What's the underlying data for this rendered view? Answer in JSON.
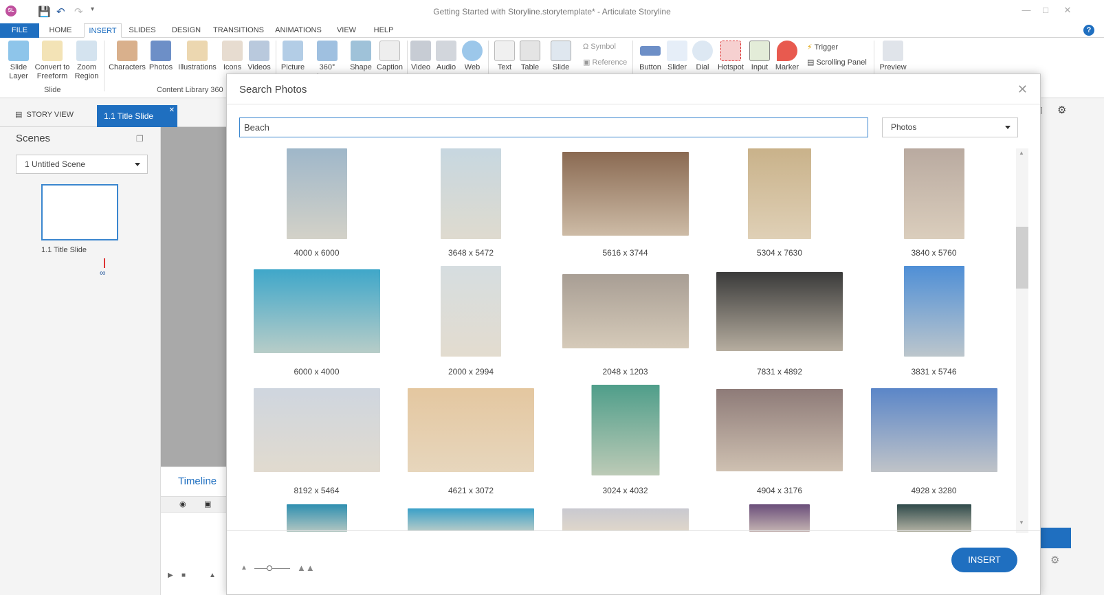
{
  "app": {
    "logo_text": "SL",
    "window_title": "Getting Started with Storyline.storytemplate* - Articulate Storyline"
  },
  "menu": {
    "tabs": [
      "FILE",
      "HOME",
      "INSERT",
      "SLIDES",
      "DESIGN",
      "TRANSITIONS",
      "ANIMATIONS",
      "VIEW",
      "HELP"
    ],
    "active": "INSERT"
  },
  "ribbon": {
    "slide_group": {
      "slide_layer": "Slide\nLayer",
      "convert": "Convert to\nFreeform",
      "zoom": "Zoom\nRegion",
      "label": "Slide"
    },
    "content_group": {
      "characters": "Characters",
      "photos": "Photos",
      "illustrations": "Illustrations",
      "icons": "Icons",
      "videos": "Videos",
      "label": "Content Library 360"
    },
    "media_group": {
      "picture": "Picture",
      "image360": "360° Image",
      "shape": "Shape",
      "caption": "Caption",
      "video": "Video",
      "audio": "Audio",
      "web": "Web"
    },
    "text_group": {
      "text": "Text",
      "table": "Table",
      "slide": "Slide",
      "symbol": "Symbol",
      "reference": "Reference"
    },
    "interactive_group": {
      "button": "Button",
      "slider": "Slider",
      "dial": "Dial",
      "hotspot": "Hotspot",
      "input": "Input",
      "marker": "Marker",
      "trigger": "Trigger",
      "scrolling_panel": "Scrolling Panel"
    },
    "preview": "Preview"
  },
  "view_tabs": {
    "story_view": "STORY VIEW",
    "title_slide": "1.1 Title Slide"
  },
  "scenes": {
    "title": "Scenes",
    "selected": "1 Untitled Scene",
    "thumb_label": "1.1 Title Slide"
  },
  "timeline": {
    "title": "Timeline"
  },
  "dialog": {
    "title": "Search Photos",
    "search_value": "Beach",
    "type_value": "Photos",
    "insert_label": "INSERT",
    "photos": [
      {
        "size": "4000 x 6000",
        "color": "#9fb7c9"
      },
      {
        "size": "3648 x 5472",
        "color": "#c7d7e0"
      },
      {
        "size": "5616 x 3744",
        "color": "#8a6a52"
      },
      {
        "size": "5304 x 7630",
        "color": "#c9b28a"
      },
      {
        "size": "3840 x 5760",
        "color": "#b9aaa0"
      },
      {
        "size": "6000 x 4000",
        "color": "#3fa7c9"
      },
      {
        "size": "2000 x 2994",
        "color": "#d6dde0"
      },
      {
        "size": "2048 x 1203",
        "color": "#a89e94"
      },
      {
        "size": "7831 x 4892",
        "color": "#3a3a3a"
      },
      {
        "size": "3831 x 5746",
        "color": "#4f8fd6"
      },
      {
        "size": "8192 x 5464",
        "color": "#cfd6df"
      },
      {
        "size": "4621 x 3072",
        "color": "#e4c7a0"
      },
      {
        "size": "3024 x 4032",
        "color": "#4f9e8a"
      },
      {
        "size": "4904 x 3176",
        "color": "#8e7b78"
      },
      {
        "size": "4928 x 3280",
        "color": "#5b86c8"
      },
      {
        "size": "",
        "color": "#2e8fb0"
      },
      {
        "size": "",
        "color": "#3aa0c8"
      },
      {
        "size": "",
        "color": "#c9c9d0"
      },
      {
        "size": "",
        "color": "#6a4e7a"
      },
      {
        "size": "",
        "color": "#2f4a4a"
      }
    ]
  }
}
